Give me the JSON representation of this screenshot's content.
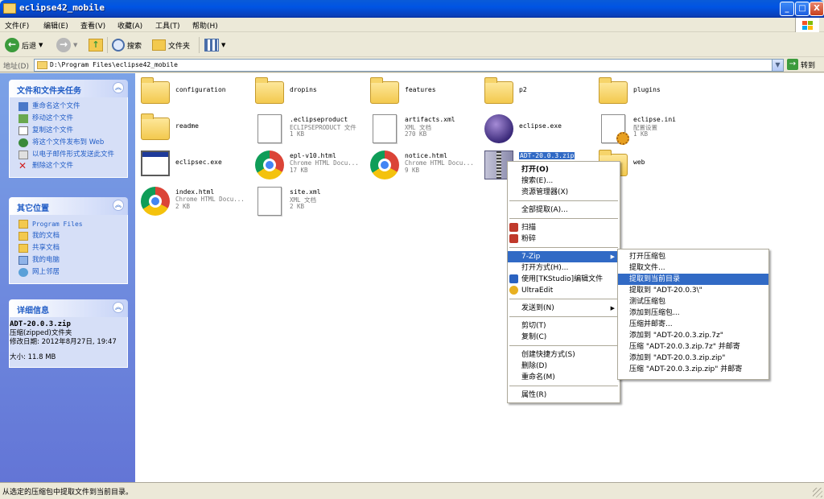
{
  "window": {
    "title": "eclipse42_mobile",
    "buttons": {
      "minimize": "_",
      "maximize": "□",
      "close": "X"
    }
  },
  "menubar": [
    "文件(F)",
    "编辑(E)",
    "查看(V)",
    "收藏(A)",
    "工具(T)",
    "帮助(H)"
  ],
  "toolbar": {
    "back_label": "后退",
    "search_label": "搜索",
    "folders_label": "文件夹"
  },
  "address": {
    "label": "地址(D)",
    "value": "D:\\Program Files\\eclipse42_mobile",
    "go_label": "转到"
  },
  "sidebar": {
    "tasks": {
      "title": "文件和文件夹任务",
      "items": [
        "重命名这个文件",
        "移动这个文件",
        "复制这个文件",
        "将这个文件发布到 Web",
        "以电子邮件形式发送此文件",
        "删除这个文件"
      ]
    },
    "places": {
      "title": "其它位置",
      "items": [
        "Program Files",
        "我的文档",
        "共享文档",
        "我的电脑",
        "网上邻居"
      ]
    },
    "details": {
      "title": "详细信息",
      "filename": "ADT-20.0.3.zip",
      "type": "压缩(zipped)文件夹",
      "modified_label": "修改日期: 2012年8月27日, 19:47",
      "size_label": "大小: 11.8 MB"
    }
  },
  "files": [
    {
      "name": "configuration",
      "kind": "folder"
    },
    {
      "name": "dropins",
      "kind": "folder"
    },
    {
      "name": "features",
      "kind": "folder"
    },
    {
      "name": "p2",
      "kind": "folder"
    },
    {
      "name": "plugins",
      "kind": "folder"
    },
    {
      "name": "readme",
      "kind": "folder"
    },
    {
      "name": ".eclipseproduct",
      "type": "ECLIPSEPRODUCT 文件",
      "size": "1 KB",
      "kind": "doc"
    },
    {
      "name": "artifacts.xml",
      "type": "XML 文档",
      "size": "270 KB",
      "kind": "xml"
    },
    {
      "name": "eclipse.exe",
      "kind": "eclipse"
    },
    {
      "name": "eclipse.ini",
      "type": "配置设置",
      "size": "1 KB",
      "kind": "ini"
    },
    {
      "name": "eclipsec.exe",
      "kind": "exe"
    },
    {
      "name": "epl-v10.html",
      "type": "Chrome HTML Docu...",
      "size": "17 KB",
      "kind": "chrome"
    },
    {
      "name": "notice.html",
      "type": "Chrome HTML Docu...",
      "size": "9 KB",
      "kind": "chrome"
    },
    {
      "name": "ADT-20.0.3.zip",
      "kind": "zip"
    },
    {
      "name": "web",
      "kind": "folder"
    },
    {
      "name": "index.html",
      "type": "Chrome HTML Docu...",
      "size": "2 KB",
      "kind": "chrome"
    },
    {
      "name": "site.xml",
      "type": "XML 文档",
      "size": "2 KB",
      "kind": "xml"
    }
  ],
  "context_menu": {
    "items": [
      "打开(O)",
      "搜索(E)...",
      "资源管理器(X)",
      "全部提取(A)...",
      "扫描",
      "粉碎",
      "7-Zip",
      "打开方式(H)...",
      "使用[TKStudio]编辑文件",
      "UltraEdit",
      "发送到(N)",
      "剪切(T)",
      "复制(C)",
      "创建快捷方式(S)",
      "删除(D)",
      "重命名(M)",
      "属性(R)"
    ]
  },
  "submenu_7zip": {
    "items": [
      "打开压缩包",
      "提取文件...",
      "提取到当前目录",
      "提取到 \"ADT-20.0.3\\\"",
      "测试压缩包",
      "添加到压缩包...",
      "压缩并邮寄...",
      "添加到 \"ADT-20.0.3.zip.7z\"",
      "压缩 \"ADT-20.0.3.zip.7z\" 并邮寄",
      "添加到 \"ADT-20.0.3.zip.zip\"",
      "压缩 \"ADT-20.0.3.zip.zip\" 并邮寄"
    ]
  },
  "status": {
    "text": "从选定的压缩包中提取文件到当前目录。"
  },
  "colors": {
    "titlebar": "#0054e3",
    "sidebar": "#6d8ee0",
    "highlight": "#316ac5",
    "link": "#215dc6"
  }
}
